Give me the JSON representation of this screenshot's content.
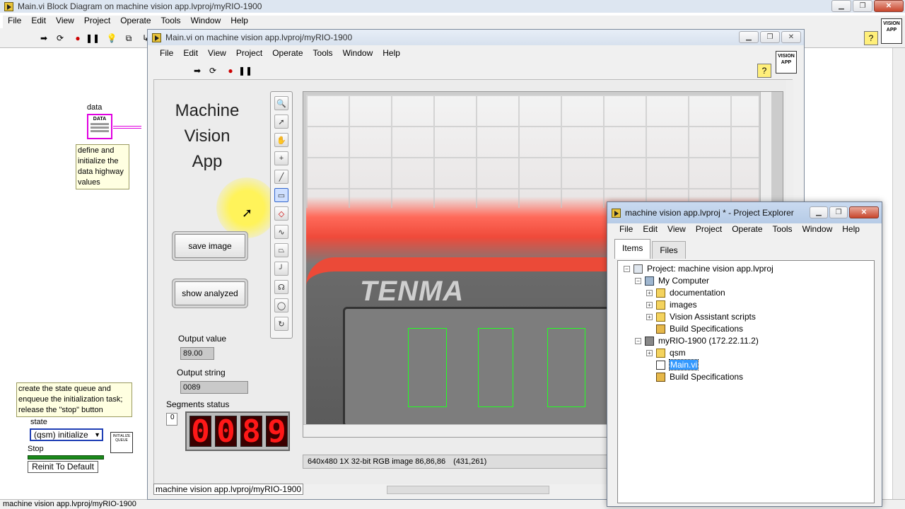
{
  "bd_window": {
    "title": "Main.vi Block Diagram on machine vision app.lvproj/myRIO-1900",
    "menu": [
      "File",
      "Edit",
      "View",
      "Project",
      "Operate",
      "Tools",
      "Window",
      "Help"
    ],
    "labels": {
      "data": "data",
      "data_box": "DATA",
      "state": "state",
      "stop": "Stop"
    },
    "comment1": "define and initialize the data highway values",
    "comment2": "create the state queue and enqueue the initialization task; release the \"stop\" button",
    "state_value": "(qsm) initialize",
    "reinit": "Reinit To Default",
    "init_queue": "INITIALIZE QUEUE",
    "status_path": "machine vision app.lvproj/myRIO-1900",
    "badge": "VISION APP"
  },
  "fp_window": {
    "title": "Main.vi on machine vision app.lvproj/myRIO-1900",
    "menu": [
      "File",
      "Edit",
      "View",
      "Project",
      "Operate",
      "Tools",
      "Window",
      "Help"
    ],
    "badge": "VISION APP",
    "app_title_lines": [
      "Machine",
      "Vision",
      "App"
    ],
    "save_button": "save image",
    "show_button": "show analyzed",
    "output_value_label": "Output value",
    "output_value": "89.00",
    "output_string_label": "Output string",
    "output_string": "0089",
    "segments_label": "Segments status",
    "segments_index": "0",
    "segments": [
      "0",
      "0",
      "8",
      "9"
    ],
    "image_brand": "TENMA",
    "image_info": "640x480 1X 32-bit RGB image 86,86,86",
    "image_coords": "(431,261)",
    "status_path": "machine vision app.lvproj/myRIO-1900"
  },
  "pe_window": {
    "title": "machine vision app.lvproj * - Project Explorer",
    "menu": [
      "File",
      "Edit",
      "View",
      "Project",
      "Operate",
      "Tools",
      "Window",
      "Help"
    ],
    "tabs": [
      "Items",
      "Files"
    ],
    "tree": [
      {
        "label": "Project: machine vision app.lvproj",
        "level": 0,
        "exp": "−",
        "icon": "project-icon"
      },
      {
        "label": "My Computer",
        "level": 1,
        "exp": "−",
        "icon": "computer-icon"
      },
      {
        "label": "documentation",
        "level": 2,
        "exp": "+",
        "icon": "folder-icon"
      },
      {
        "label": "images",
        "level": 2,
        "exp": "+",
        "icon": "folder-icon"
      },
      {
        "label": "Vision Assistant scripts",
        "level": 2,
        "exp": "+",
        "icon": "folder-icon"
      },
      {
        "label": "Build Specifications",
        "level": 2,
        "exp": "",
        "icon": "build-icon"
      },
      {
        "label": "myRIO-1900 (172.22.11.2)",
        "level": 1,
        "exp": "−",
        "icon": "target-icon"
      },
      {
        "label": "qsm",
        "level": 2,
        "exp": "+",
        "icon": "folder-icon"
      },
      {
        "label": "Main.vi",
        "level": 2,
        "exp": "",
        "icon": "vi-icon",
        "selected": true
      },
      {
        "label": "Build Specifications",
        "level": 2,
        "exp": "",
        "icon": "build-icon"
      }
    ]
  },
  "colors": {
    "accent": "#3399ff",
    "wire_pink": "#e000e0",
    "wire_green": "#1a8a1a",
    "roi_green": "#22ff22",
    "led_red": "#ff1818"
  }
}
